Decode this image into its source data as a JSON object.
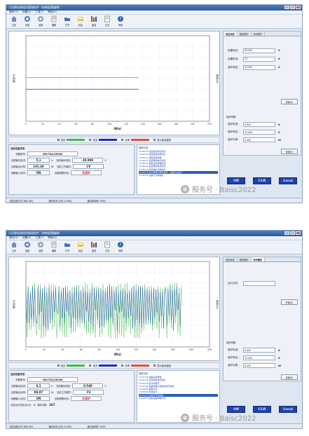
{
  "window": {
    "title": "六氏模电源程控管理软件（参数配置编辑）",
    "menu": [
      "操作(O)",
      "设置(S)",
      "工具(T)",
      "帮助(H)"
    ]
  },
  "toolbar": [
    "主页",
    "连接",
    "设置",
    "编辑",
    "打开",
    "标定",
    "曲线",
    "日志",
    "帮助"
  ],
  "chart_top": {
    "type": "line",
    "xlabel": "时(s)",
    "ylabel_left": "电压(V)",
    "ylabel_right": "电流(A)",
    "xlim": [
      0,
      220
    ],
    "x_ticks": [
      "0",
      "20",
      "40",
      "60",
      "80",
      "100",
      "120",
      "140",
      "160",
      "180",
      "200",
      "220"
    ],
    "series": [
      {
        "name": "电压",
        "color": "#3dbb4a",
        "x": [
          0,
          135
        ],
        "y": [
          8.2,
          8.2
        ]
      },
      {
        "name": "电流",
        "color": "#1f2fb0",
        "x": [
          0,
          135
        ],
        "y": [
          6.0,
          6.0
        ]
      }
    ],
    "ylim": [
      0,
      16
    ]
  },
  "chart_bottom": {
    "type": "line",
    "xlabel": "时(s)",
    "ylabel_left": "电压(V)",
    "ylabel_right": "电流(A)",
    "xlim": [
      0,
      200
    ],
    "x_ticks": [
      "0",
      "20",
      "40",
      "60",
      "80",
      "100",
      "120",
      "140",
      "160",
      "180",
      "200"
    ],
    "series": [
      {
        "name": "电压",
        "color": "#3dbb4a"
      },
      {
        "name": "电流",
        "color": "#1f4fb0"
      }
    ],
    "ylim": [
      0,
      16
    ]
  },
  "legend": {
    "voltage": "电压",
    "current": "电流",
    "power": "功率",
    "auto": "显示曲线缩放"
  },
  "info_top": {
    "title": "当前设备状态",
    "device_label": "设备型号:",
    "device_value": "30V/70A/1500W",
    "rows": [
      {
        "l1": "当前输出电流:",
        "v1": "5.1",
        "u1": "A",
        "l2": "当前输出电压:",
        "v2": "29.999",
        "u2": "V"
      },
      {
        "l1": "当前输出功率:",
        "v1": "101.40",
        "u1": "W",
        "l2": "当前工作模式:",
        "v2": "CV",
        "u2": ""
      },
      {
        "l1": "设备输入状态:",
        "v1": "ON",
        "u1": "",
        "l2": "当前报警状态:",
        "v2": "无保护",
        "u2": ""
      }
    ]
  },
  "info_bottom": {
    "title": "当前设备状态",
    "device_label": "设备型号:",
    "device_value": "30V/70A/1500W",
    "rows": [
      {
        "l1": "当前输出电流:",
        "v1": "6.1",
        "u1": "A",
        "l2": "当前输出电压:",
        "v2": "0.548",
        "u2": "V"
      },
      {
        "l1": "当前输出功率:",
        "v1": "88.07",
        "u1": "W",
        "l2": "当前工作模式:",
        "v2": "CV",
        "u2": ""
      },
      {
        "l1": "设备输入状态:",
        "v1": "ON",
        "u1": "",
        "l2": "当前报警状态:",
        "v2": "无保护",
        "u2": ""
      }
    ],
    "extra_label": "当前运行状态(步/分):",
    "extra_value": "0",
    "steps_label": "循环次数:",
    "steps_value": "267"
  },
  "log_top": {
    "title": "操作日志",
    "lines": [
      "14:49:10 设置输出电压成功",
      "14:49:10 设置输出电流成功",
      "14:49:11 读取设备参数",
      "14:49:11 设置保护电压成功",
      "14:49:12 读取设备参数成功",
      "14:49:12 设置保护电流成功",
      "14:49:14 设置保护功率成功",
      "14:49:14 运行参数已保存完毕，设备正在运行",
      "14:49:15 设备已开启输出"
    ]
  },
  "log_bottom": {
    "title": "操作日志",
    "lines": [
      "14:57:03 读取设备参数",
      "14:57:03 设置输出电压成功",
      "14:57:03 运行中断开",
      "14:57:06 设备参数已读取并进行恢复",
      "14:58:01 编程文件",
      "14:58:02 成功运行",
      "14:58:02 设备已开启输出",
      "14:58:03 读取设备参数成功"
    ]
  },
  "right_top": {
    "tabs": [
      "电压电流",
      "程控模式",
      "序列模式"
    ],
    "set_rows": [
      {
        "label": "设置电压:",
        "value": "30.000",
        "unit": "V"
      },
      {
        "label": "设置电流:",
        "value": "70",
        "unit": "A"
      },
      {
        "label": "保护电压:",
        "value": "32.000",
        "unit": "V"
      }
    ],
    "apply_label": "设置(S)",
    "protect_title": "保护参数",
    "protect_rows": [
      {
        "label": "保护电流:",
        "value": "0.000",
        "unit": "A"
      },
      {
        "label": "保护电压:",
        "value": "32.000",
        "unit": "V"
      },
      {
        "label": "保护功率:",
        "value": "0.000",
        "unit": "W"
      }
    ],
    "protect_apply": "设置(S)"
  },
  "right_bottom": {
    "tabs": [
      "电压电流",
      "程控模式",
      "序列模式"
    ],
    "file_label": "运行文件:",
    "file_value": "",
    "apply_label": "开始(S)",
    "protect_title": "保护参数",
    "protect_rows": [
      {
        "label": "保护电流:",
        "value": "0.000",
        "unit": "A"
      },
      {
        "label": "保护电压:",
        "value": "32.000",
        "unit": "V"
      },
      {
        "label": "保护功率:",
        "value": "0.000",
        "unit": "W"
      }
    ],
    "protect_apply": "设置(S)"
  },
  "buttons": {
    "off": "Off",
    "clr": "CLR",
    "local": "Local"
  },
  "status_top": [
    "当前连接方式:本地 (RS)",
    "通讯状态:正常 (COM6)",
    "通讯波特率: 9600"
  ],
  "status_bottom": [
    "当前连接方式:本地 (RS)",
    "通讯状态:正常 (COM6)",
    "通讯波特率: 9600"
  ],
  "watermark": "服务号 · Baisc2022",
  "colors": {
    "voltage": "#3dbb4a",
    "current": "#1f2fb0",
    "power": "#e0503a",
    "button": "#1f43a8"
  }
}
